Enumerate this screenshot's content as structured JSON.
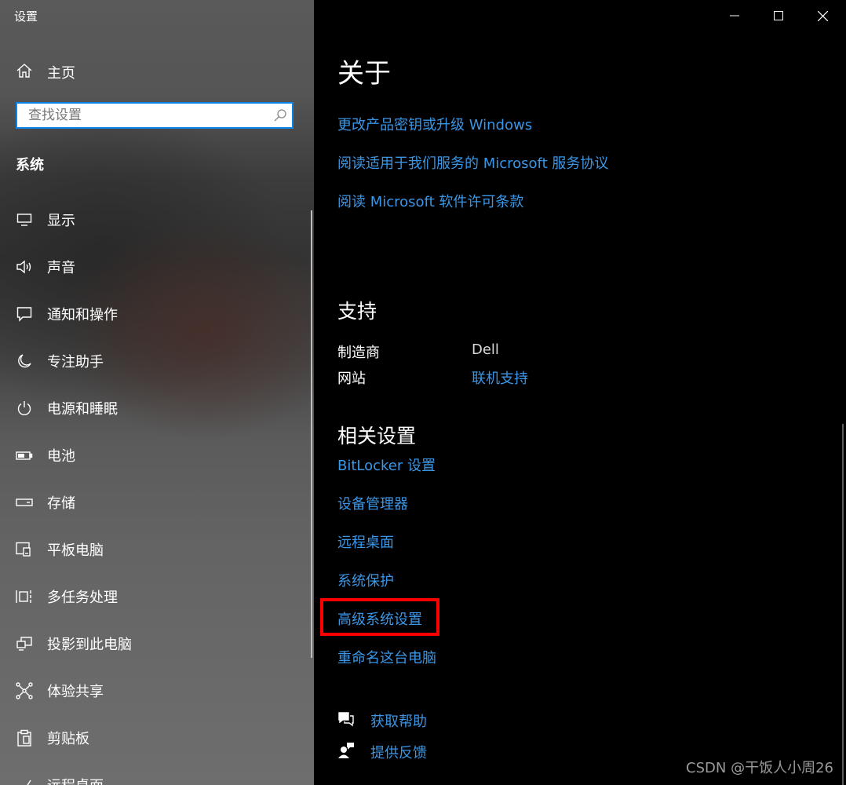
{
  "window": {
    "title": "设置"
  },
  "sidebar": {
    "home_label": "主页",
    "search_placeholder": "查找设置",
    "section_title": "系统",
    "items": [
      {
        "label": "显示",
        "icon": "monitor-icon"
      },
      {
        "label": "声音",
        "icon": "speaker-icon"
      },
      {
        "label": "通知和操作",
        "icon": "notification-icon"
      },
      {
        "label": "专注助手",
        "icon": "moon-icon"
      },
      {
        "label": "电源和睡眠",
        "icon": "power-icon"
      },
      {
        "label": "电池",
        "icon": "battery-icon"
      },
      {
        "label": "存储",
        "icon": "storage-icon"
      },
      {
        "label": "平板电脑",
        "icon": "tablet-icon"
      },
      {
        "label": "多任务处理",
        "icon": "multitasking-icon"
      },
      {
        "label": "投影到此电脑",
        "icon": "projection-icon"
      },
      {
        "label": "体验共享",
        "icon": "shared-experiences-icon"
      },
      {
        "label": "剪贴板",
        "icon": "clipboard-icon"
      },
      {
        "label": "远程桌面",
        "icon": "remote-desktop-icon"
      }
    ]
  },
  "main": {
    "title": "关于",
    "about_links": [
      "更改产品密钥或升级 Windows",
      "阅读适用于我们服务的 Microsoft 服务协议",
      "阅读 Microsoft 软件许可条款"
    ],
    "support": {
      "title": "支持",
      "rows": [
        {
          "key": "制造商",
          "value": "Dell"
        },
        {
          "key": "网站",
          "value": "联机支持"
        }
      ]
    },
    "related": {
      "title": "相关设置",
      "links": [
        "BitLocker 设置",
        "设备管理器",
        "远程桌面",
        "系统保护",
        "高级系统设置",
        "重命名这台电脑"
      ]
    },
    "help": {
      "get_help": "获取帮助",
      "feedback": "提供反馈"
    }
  },
  "watermark": "CSDN @干饭人小周26",
  "colors": {
    "link": "#3a96e6",
    "highlight": "#ff0000",
    "search_border": "#0a84e8"
  }
}
